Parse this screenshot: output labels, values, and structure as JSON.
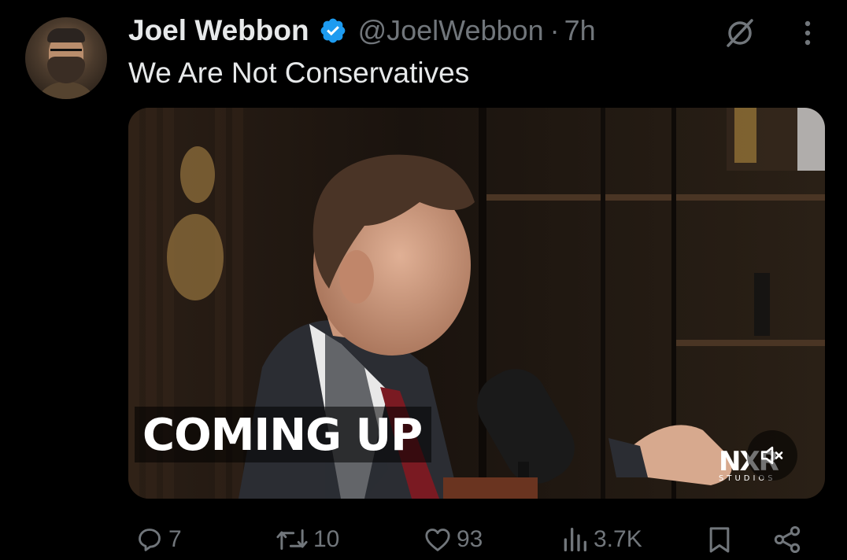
{
  "author": {
    "name": "Joel Webbon",
    "handle": "@JoelWebbon",
    "separator": "·",
    "time": "7h"
  },
  "tweet": {
    "text": "We Are Not Conservatives"
  },
  "media": {
    "caption": "COMING UP",
    "brand_mark": "NXR",
    "brand_sub": "STUDIOS"
  },
  "actions": {
    "replies": "7",
    "reposts": "10",
    "likes": "93",
    "views": "3.7K"
  },
  "colors": {
    "background": "#000000",
    "text": "#e7e9ea",
    "muted": "#71767b",
    "verified": "#1d9bf0"
  },
  "icons": [
    "verified-icon",
    "grok-icon",
    "more-icon",
    "mute-icon",
    "reply-icon",
    "repost-icon",
    "like-icon",
    "views-icon",
    "bookmark-icon",
    "share-icon"
  ]
}
